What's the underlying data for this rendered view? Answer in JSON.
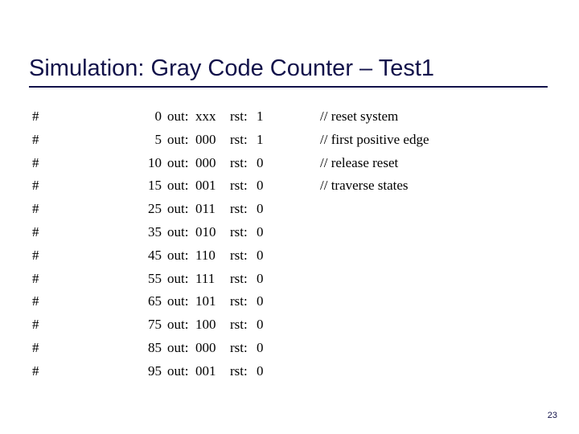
{
  "slide": {
    "title": "Simulation: Gray Code Counter – Test1",
    "title_color": "#12124a",
    "background_color": "#ffffff",
    "body_text_color": "#000000",
    "page_number": "23"
  },
  "listing": {
    "prefix_symbol": "#",
    "out_label": "out:",
    "rst_label": "rst:",
    "rows": [
      {
        "hash": "#",
        "time": "0",
        "out_label": "out:",
        "out": "xxx",
        "rst_label": "rst:",
        "rst": "1",
        "comment": "// reset system"
      },
      {
        "hash": "#",
        "time": "5",
        "out_label": "out:",
        "out": "000",
        "rst_label": "rst:",
        "rst": "1",
        "comment": "// first positive edge"
      },
      {
        "hash": "#",
        "time": "10",
        "out_label": "out:",
        "out": "000",
        "rst_label": "rst:",
        "rst": "0",
        "comment": "// release reset"
      },
      {
        "hash": "#",
        "time": "15",
        "out_label": "out:",
        "out": "001",
        "rst_label": "rst:",
        "rst": "0",
        "comment": "// traverse states"
      },
      {
        "hash": "#",
        "time": "25",
        "out_label": "out:",
        "out": "011",
        "rst_label": "rst:",
        "rst": "0",
        "comment": ""
      },
      {
        "hash": "#",
        "time": "35",
        "out_label": "out:",
        "out": "010",
        "rst_label": "rst:",
        "rst": "0",
        "comment": ""
      },
      {
        "hash": "#",
        "time": "45",
        "out_label": "out:",
        "out": "110",
        "rst_label": "rst:",
        "rst": "0",
        "comment": ""
      },
      {
        "hash": "#",
        "time": "55",
        "out_label": "out:",
        "out": "111",
        "rst_label": "rst:",
        "rst": "0",
        "comment": ""
      },
      {
        "hash": "#",
        "time": "65",
        "out_label": "out:",
        "out": "101",
        "rst_label": "rst:",
        "rst": "0",
        "comment": ""
      },
      {
        "hash": "#",
        "time": "75",
        "out_label": "out:",
        "out": "100",
        "rst_label": "rst:",
        "rst": "0",
        "comment": ""
      },
      {
        "hash": "#",
        "time": "85",
        "out_label": "out:",
        "out": "000",
        "rst_label": "rst:",
        "rst": "0",
        "comment": ""
      },
      {
        "hash": "#",
        "time": "95",
        "out_label": "out:",
        "out": "001",
        "rst_label": "rst:",
        "rst": "0",
        "comment": ""
      }
    ]
  }
}
